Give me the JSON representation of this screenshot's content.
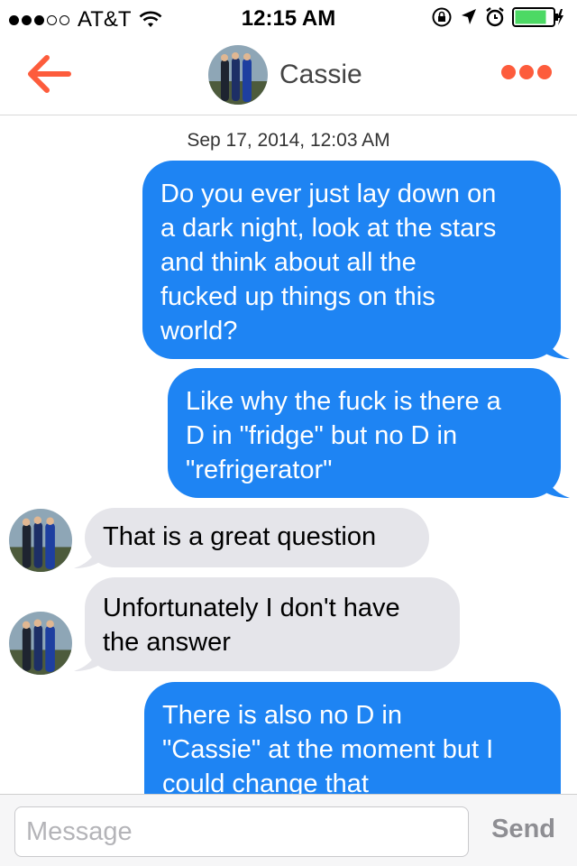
{
  "status_bar": {
    "carrier": "AT&T",
    "time": "12:15 AM"
  },
  "nav": {
    "title": "Cassie",
    "accent_color": "#fd5c3c"
  },
  "chat": {
    "timestamp": "Sep 17, 2014, 12:03 AM",
    "messages": [
      {
        "direction": "outgoing",
        "text": "Do you ever just lay down on\na dark night, look at the stars\nand think about all the\nfucked up things on this\nworld?"
      },
      {
        "direction": "outgoing",
        "text": "Like why the fuck is there a\nD in \"fridge\" but no D in\n\"refrigerator\""
      },
      {
        "direction": "incoming",
        "text": "That is a great question"
      },
      {
        "direction": "incoming",
        "text": "Unfortunately I don't have\nthe answer"
      },
      {
        "direction": "outgoing",
        "text": "There is also no D in\n\"Cassie\" at the moment but I\ncould change that"
      }
    ],
    "outgoing_color": "#1e84f3",
    "incoming_color": "#e5e5ea"
  },
  "input": {
    "placeholder": "Message",
    "send_label": "Send"
  }
}
